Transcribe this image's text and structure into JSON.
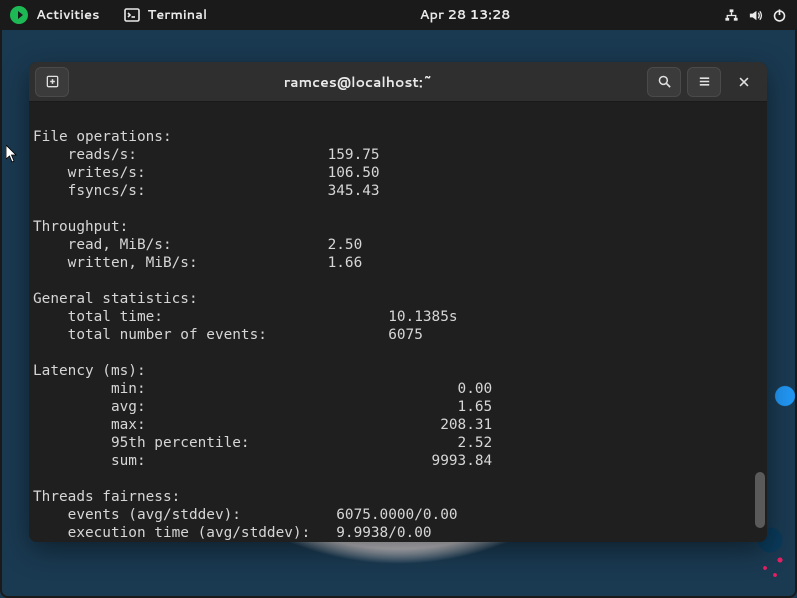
{
  "topbar": {
    "activities": "Activities",
    "app_label": "Terminal",
    "datetime": "Apr 28  13:28"
  },
  "window": {
    "title": "ramces@localhost:~"
  },
  "term": {
    "s1_title": "File operations:",
    "s1_l1": "    reads/s:                      159.75",
    "s1_l2": "    writes/s:                     106.50",
    "s1_l3": "    fsyncs/s:                     345.43",
    "s2_title": "Throughput:",
    "s2_l1": "    read, MiB/s:                  2.50",
    "s2_l2": "    written, MiB/s:               1.66",
    "s3_title": "General statistics:",
    "s3_l1": "    total time:                          10.1385s",
    "s3_l2": "    total number of events:              6075",
    "s4_title": "Latency (ms):",
    "s4_l1": "         min:                                    0.00",
    "s4_l2": "         avg:                                    1.65",
    "s4_l3": "         max:                                  208.31",
    "s4_l4": "         95th percentile:                        2.52",
    "s4_l5": "         sum:                                 9993.84",
    "s5_title": "Threads fairness:",
    "s5_l1": "    events (avg/stddev):           6075.0000/0.00",
    "s5_l2": "    execution time (avg/stddev):   9.9938/0.00"
  }
}
